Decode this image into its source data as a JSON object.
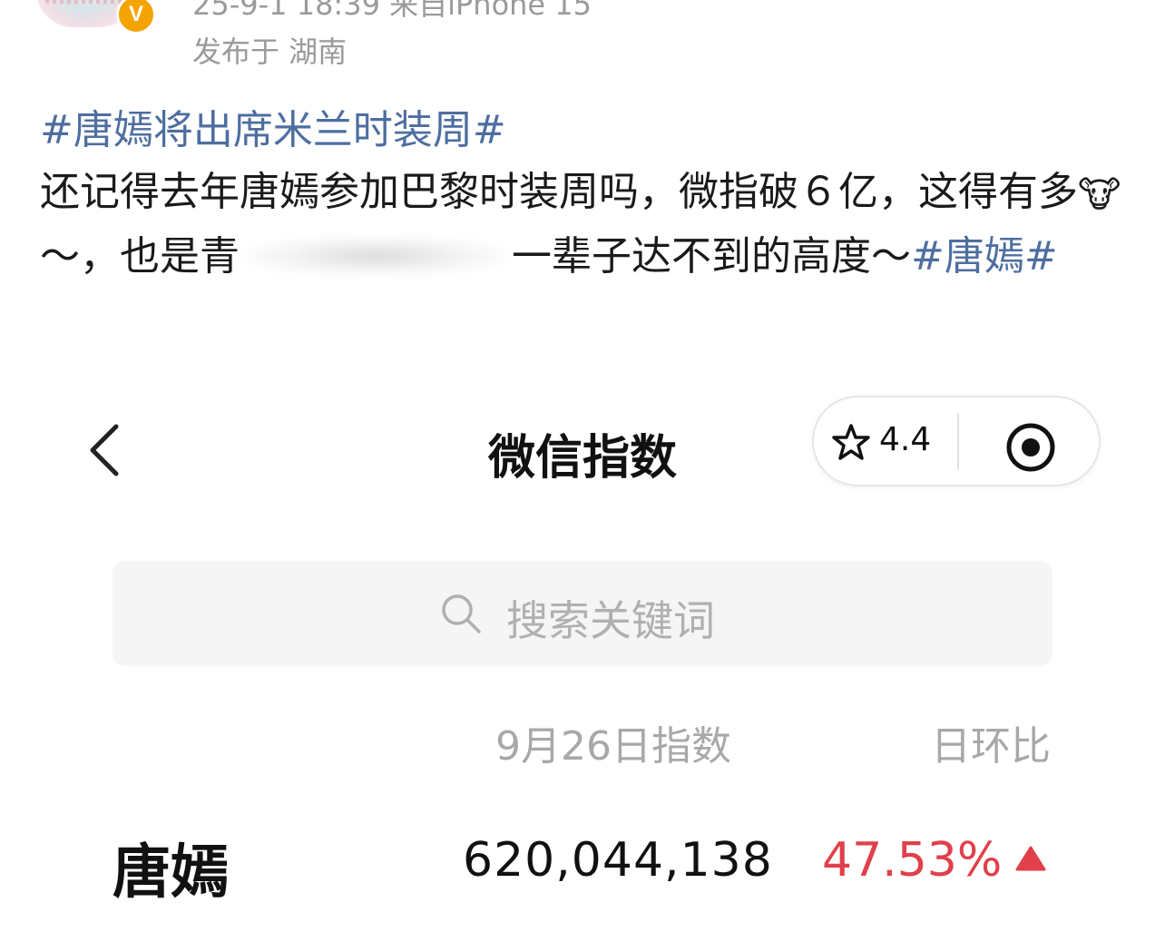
{
  "post": {
    "meta_line_1": "25-9-1 18:39  来自iPhone 15",
    "meta_line_2": "发布于 湖南",
    "verified_badge": "V",
    "topic_1": "#唐嫣将出席米兰时装周#",
    "text_1": "还记得去年唐嫣参加巴黎时装周吗，微指破６亿，这得有多",
    "emoji": "🐮",
    "text_2": "～，也是",
    "text_3a": "青",
    "text_3b": "一辈子达不到的高度～",
    "topic_2": "#唐嫣#"
  },
  "wechat_index": {
    "title": "微信指数",
    "rating": "4.4",
    "search_placeholder": "搜索关键词",
    "column_date": "9月26日指数",
    "column_change": "日环比",
    "keyword": "唐嫣",
    "value": "620,044,138",
    "change": "47.53%",
    "change_color": "#e0404a",
    "icons": [
      "back-chevron-icon",
      "star-icon",
      "target-icon",
      "search-icon",
      "triangle-up-icon"
    ]
  }
}
